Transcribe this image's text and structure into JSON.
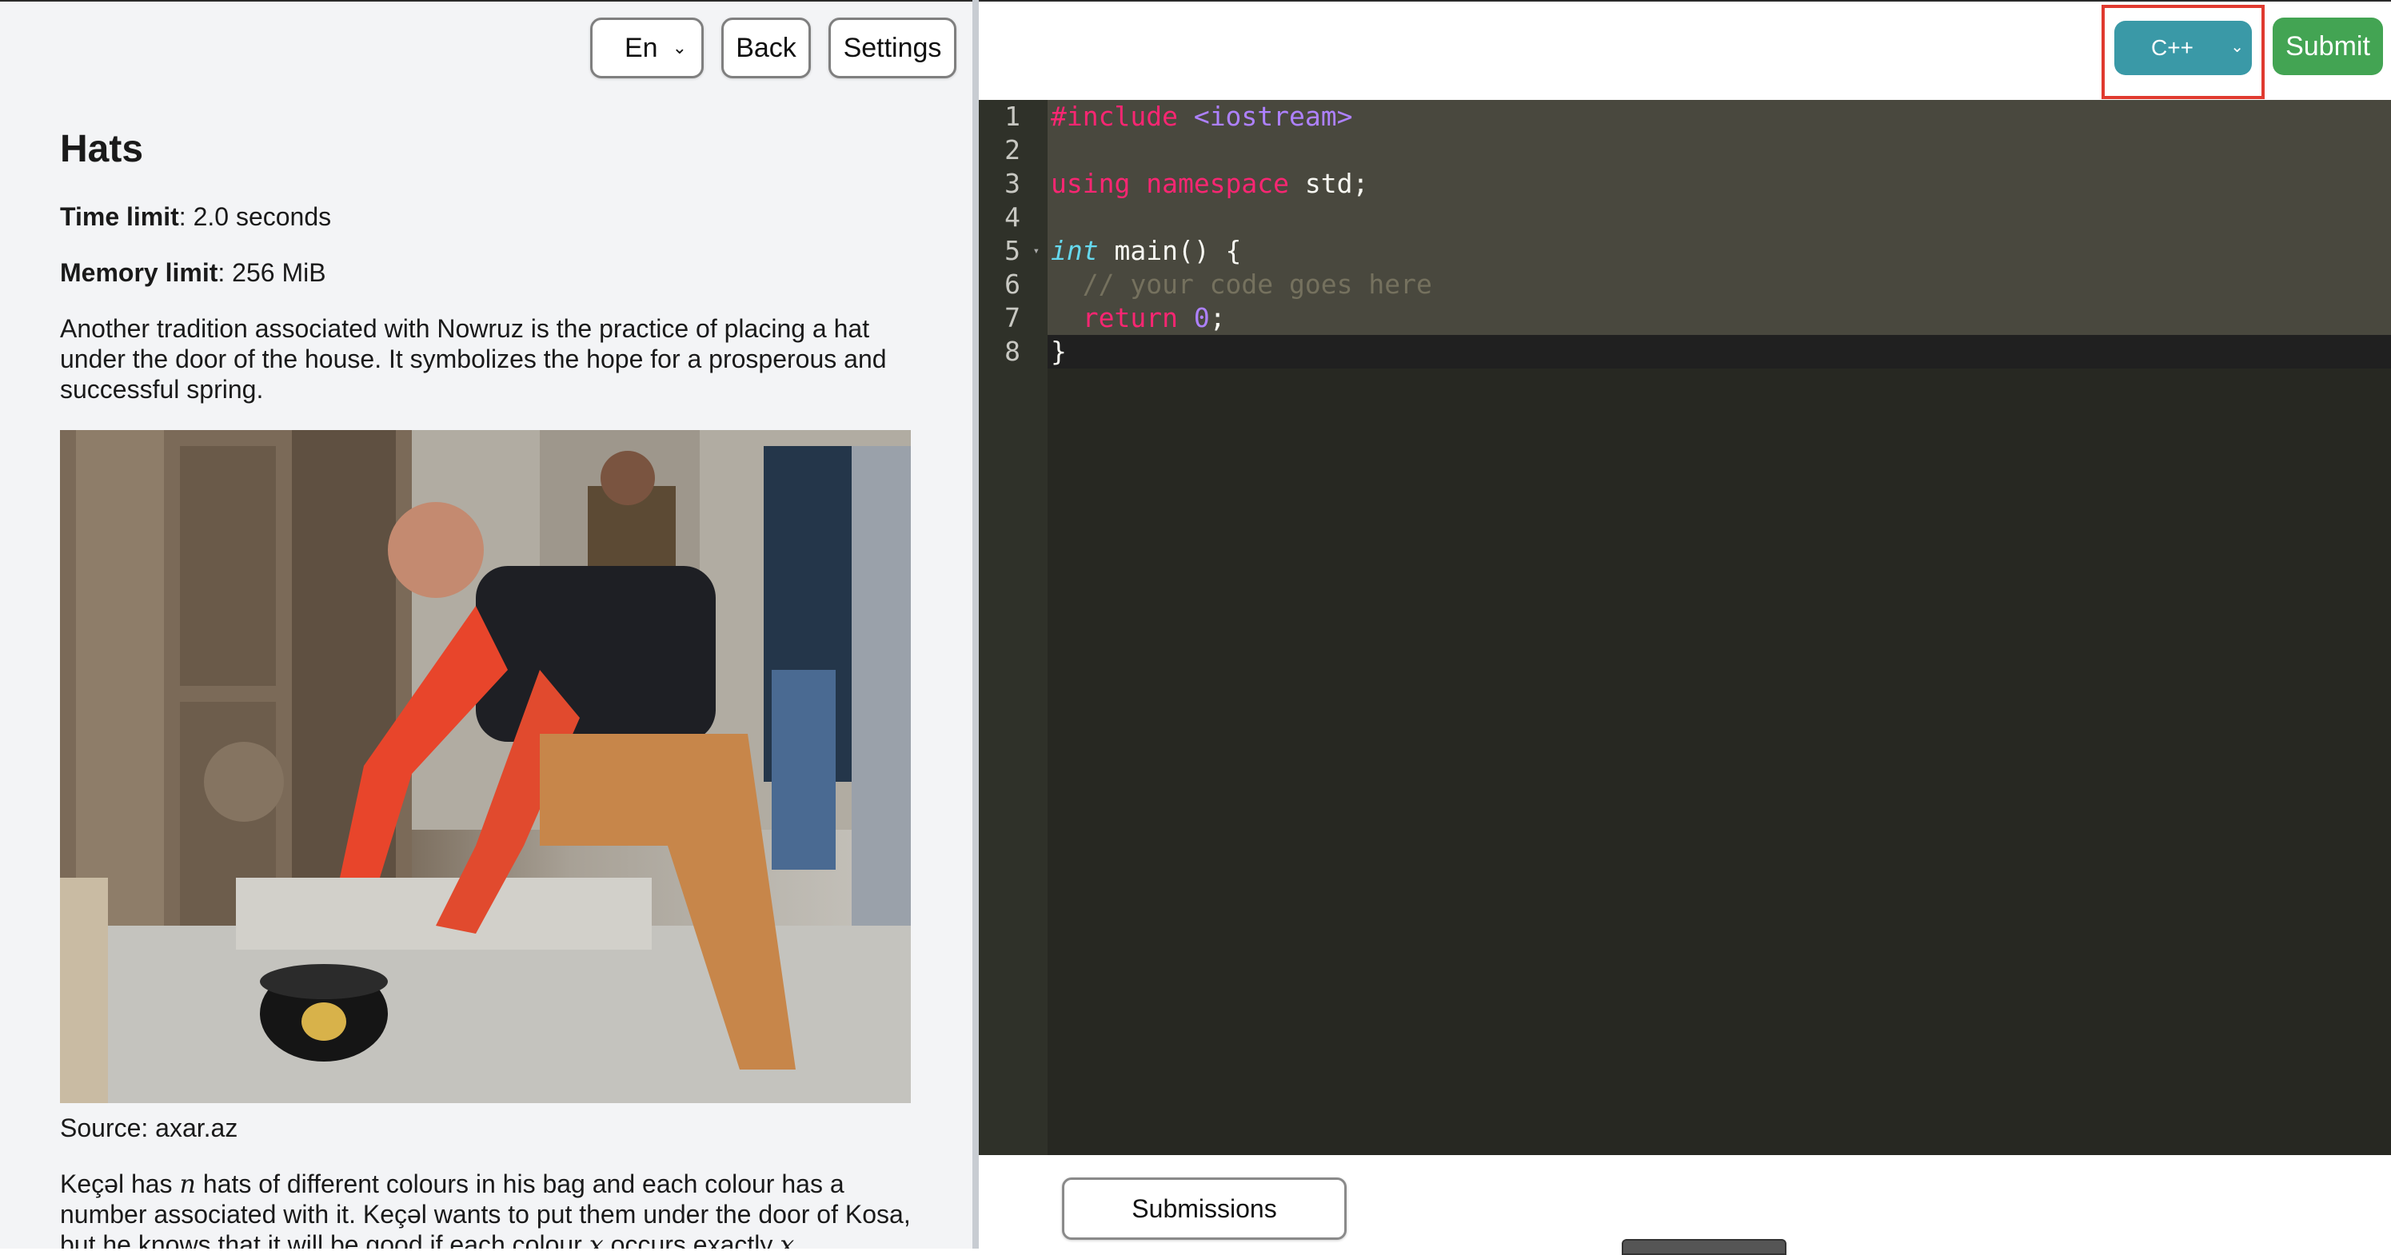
{
  "toolbar": {
    "language_selected": "En",
    "back_label": "Back",
    "settings_label": "Settings"
  },
  "problem": {
    "title": "Hats",
    "time_limit_label": "Time limit",
    "time_limit_value": ": 2.0 seconds",
    "memory_limit_label": "Memory limit",
    "memory_limit_value": ": 256 MiB",
    "intro": "Another tradition associated with Nowruz is the practice of placing a hat under the door of the house. It symbolizes the hope for a prosperous and successful spring.",
    "photo_caption": "Source: axar.az",
    "statement_part1": "Keçəl has ",
    "statement_var_n": "n",
    "statement_part2": " hats of different colours in his bag and each colour has a number associated with it. Keçəl wants to put them under the door of Kosa, but he knows that it will be good if each colour ",
    "statement_var_x": "x",
    "statement_part3": " occurs exactly ",
    "statement_var_x2": "x"
  },
  "editor_toolbar": {
    "code_language": "C++",
    "submit_label": "Submit"
  },
  "editor": {
    "line_numbers": [
      "1",
      "2",
      "3",
      "4",
      "5",
      "6",
      "7",
      "8"
    ],
    "line1_directive": "#include",
    "line1_header": " <iostream>",
    "line3_kw1": "using",
    "line3_kw2": " namespace",
    "line3_rest": " std;",
    "line5_type": "int",
    "line5_rest": " main() {",
    "line6_comment": "  // your code goes here",
    "line7_indent": "  ",
    "line7_kw": "return",
    "line7_space": " ",
    "line7_num": "0",
    "line7_semi": ";",
    "line8": "}"
  },
  "bottom": {
    "submissions_label": "Submissions"
  },
  "colors": {
    "editor_bg": "#272822",
    "cpp_select_bg": "#3a99a7",
    "submit_bg": "#43a453",
    "highlight_border": "#e03a2f"
  }
}
